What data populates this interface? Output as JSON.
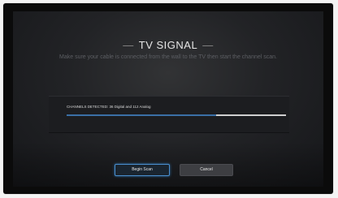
{
  "dialog": {
    "title": "TV SIGNAL",
    "subtitle": "Make sure your cable is connected from the wall to the TV then start the channel scan."
  },
  "scan": {
    "channels_label": "CHANNELS DETECTED: 36 Digital and 112 Analog",
    "progress_percent": 68,
    "progress_color": "#3a6fa6"
  },
  "buttons": {
    "begin_label": "Begin Scan",
    "cancel_label": "Cancel"
  }
}
